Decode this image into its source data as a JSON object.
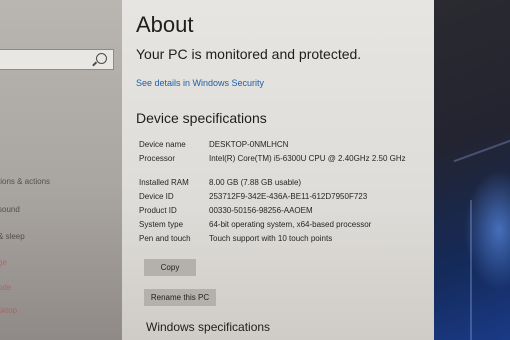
{
  "sidebar": {
    "search": {
      "icon": "search-icon"
    },
    "items": [
      {
        "label": "tions & actions"
      },
      {
        "label": "sound"
      },
      {
        "label": "& sleep"
      },
      {
        "label": "ge"
      },
      {
        "label": "ode"
      },
      {
        "label": "sktop"
      }
    ]
  },
  "main": {
    "title": "About",
    "protected": "Your PC is monitored and protected.",
    "security_link": "See details in Windows Security",
    "device_heading": "Device specifications",
    "specs": [
      {
        "label": "Device name",
        "value": "DESKTOP-0NMLHCN"
      },
      {
        "label": "Processor",
        "value": "Intel(R) Core(TM) i5-6300U CPU @ 2.40GHz   2.50 GHz"
      },
      {
        "label": "Installed RAM",
        "value": "8.00 GB (7.88 GB usable)"
      },
      {
        "label": "Device ID",
        "value": "253712F9-342E-436A-BE11-612D7950F723"
      },
      {
        "label": "Product ID",
        "value": "00330-50156-98256-AAOEM"
      },
      {
        "label": "System type",
        "value": "64-bit operating system, x64-based processor"
      },
      {
        "label": "Pen and touch",
        "value": "Touch support with 10 touch points"
      }
    ],
    "copy_label": "Copy",
    "rename_label": "Rename this PC",
    "windows_heading": "Windows specifications"
  },
  "colors": {
    "link": "#1f5fa8",
    "button_bg": "#b4b1ad",
    "desktop_blue": "#1a3a86"
  }
}
